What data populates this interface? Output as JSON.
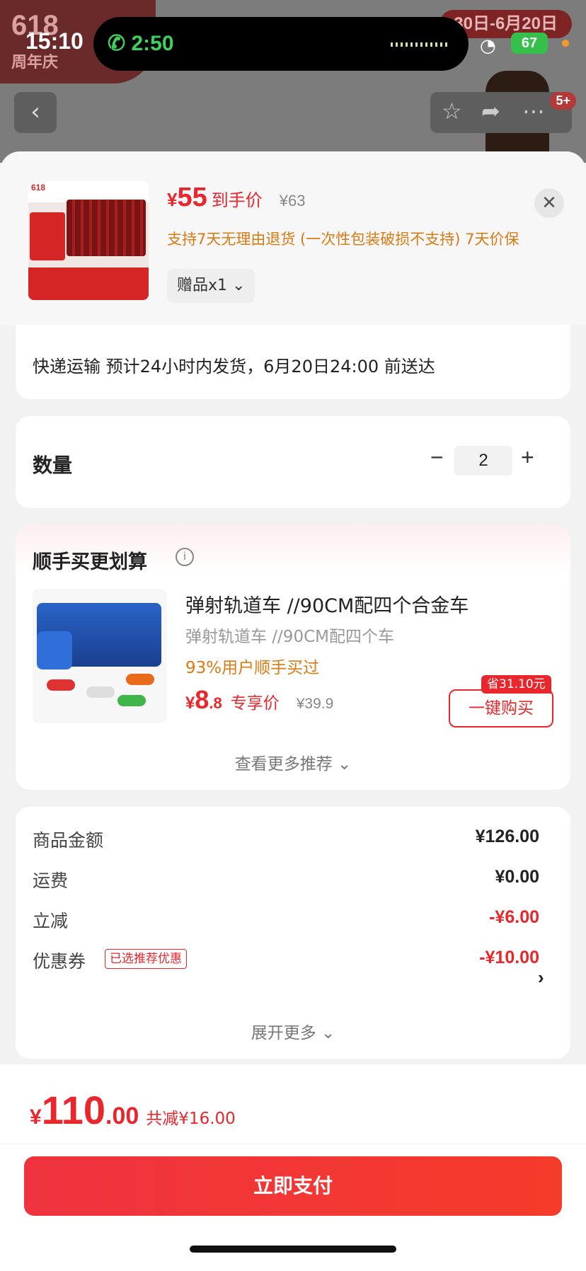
{
  "status_bar": {
    "time": "15:10",
    "call_duration": "2:50",
    "battery": "67"
  },
  "background_page": {
    "banner_title": "618",
    "banner_subtitle": "周年庆",
    "date_range": "30日-6月20日",
    "cart_badge": "5+"
  },
  "product_header": {
    "price_currency": "¥",
    "price_value": "55",
    "price_label": "到手价",
    "original_price": "¥63",
    "return_policy": "支持7天无理由退货 (一次性包装破损不支持)  7天价保",
    "gift_chip": "赠品x1"
  },
  "shipping": {
    "text": "快递运输 预计24小时内发货，6月20日24:00 前送达"
  },
  "quantity": {
    "label": "数量",
    "value": "2",
    "minus": "−",
    "plus": "+"
  },
  "recommend": {
    "title": "顺手买更划算",
    "info_icon": "i",
    "item_name": "弹射轨道车 //90CM配四个合金车",
    "item_sub": "弹射轨道车 //90CM配四个车",
    "bought_rate": "93%用户顺手买过",
    "price_currency": "¥",
    "price_int": "8",
    "price_dec": ".8",
    "price_label": "专享价",
    "original_price": "¥39.9",
    "save_tag": "省31.10元",
    "buy_button": "一键购买",
    "more_link": "查看更多推荐 ⌄"
  },
  "summary": {
    "rows": [
      {
        "label": "商品金额",
        "value": "¥126.00"
      },
      {
        "label": "运费",
        "value": "¥0.00"
      },
      {
        "label": "立减",
        "value": "-¥6.00"
      },
      {
        "label": "优惠券",
        "value": "-¥10.00"
      }
    ],
    "coupon_tag": "已选推荐优惠",
    "expand_link": "展开更多 ⌄"
  },
  "footer": {
    "currency": "¥",
    "total_int": "110",
    "total_dec": ".00",
    "total_reduce": "共减¥16.00",
    "pay_button": "立即支付"
  },
  "colors": {
    "accent_red": "#e8262b",
    "orange_text": "#d97a12"
  }
}
